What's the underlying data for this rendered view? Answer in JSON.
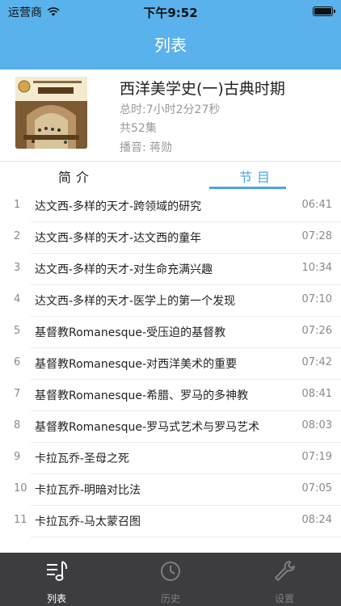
{
  "status_bar": {
    "carrier": "运营商",
    "time": "下午9:52",
    "battery_level": 0.95,
    "icons": [
      "wifi-icon",
      "battery-icon"
    ]
  },
  "nav": {
    "title": "列表"
  },
  "album": {
    "title": "西洋美学史(一)古典时期",
    "duration": "总时:7小时2分27秒",
    "episode_count": "共52集",
    "narrator": "播音:  蒋勋"
  },
  "tabs": [
    {
      "label": "简介",
      "active": false
    },
    {
      "label": "节目",
      "active": true
    }
  ],
  "episodes": [
    {
      "num": "1",
      "title": "达文西-多样的天才-跨领域的研究",
      "duration": "06:41"
    },
    {
      "num": "2",
      "title": "达文西-多样的天才-达文西的童年",
      "duration": "07:28"
    },
    {
      "num": "3",
      "title": "达文西-多样的天才-对生命充满兴趣",
      "duration": "10:34"
    },
    {
      "num": "4",
      "title": "达文西-多样的天才-医学上的第一个发现",
      "duration": "07:10"
    },
    {
      "num": "5",
      "title": "基督教Romanesque-受压迫的基督教",
      "duration": "07:26"
    },
    {
      "num": "6",
      "title": "基督教Romanesque-对西洋美术的重要",
      "duration": "07:42"
    },
    {
      "num": "7",
      "title": "基督教Romanesque-希腊、罗马的多神教",
      "duration": "08:41"
    },
    {
      "num": "8",
      "title": "基督教Romanesque-罗马式艺术与罗马艺术",
      "duration": "08:03"
    },
    {
      "num": "9",
      "title": "卡拉瓦乔-圣母之死",
      "duration": "07:19"
    },
    {
      "num": "10",
      "title": "卡拉瓦乔-明暗对比法",
      "duration": "07:05"
    },
    {
      "num": "11",
      "title": "卡拉瓦乔-马太蒙召图",
      "duration": "08:24"
    }
  ],
  "tabbar": [
    {
      "label": "列表",
      "icon": "music-list-icon",
      "active": true
    },
    {
      "label": "历史",
      "icon": "clock-icon",
      "active": false
    },
    {
      "label": "设置",
      "icon": "wrench-icon",
      "active": false
    }
  ],
  "colors": {
    "accent": "#5AB2EC",
    "tab_active": "#4aa5e6",
    "tabbar_bg": "#2d2d30"
  }
}
